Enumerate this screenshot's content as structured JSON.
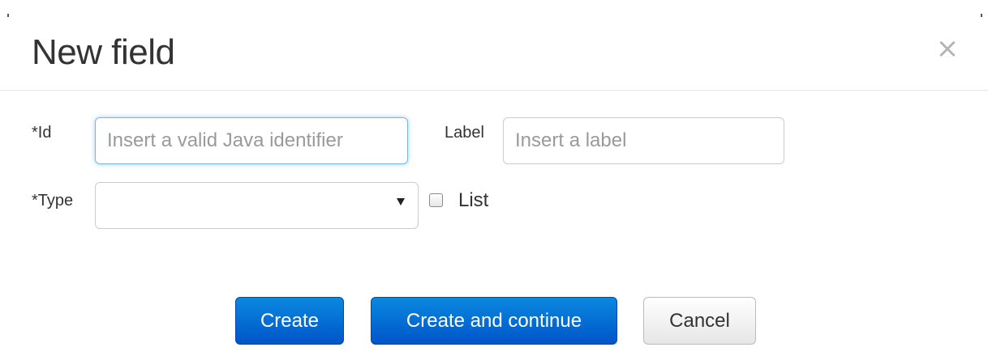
{
  "dialog": {
    "title": "New field",
    "close_symbol": "×"
  },
  "form": {
    "id_field": {
      "label": "*Id",
      "value": "",
      "placeholder": "Insert a valid Java identifier"
    },
    "label_field": {
      "label": "Label",
      "value": "",
      "placeholder": "Insert a label"
    },
    "type_field": {
      "label": "*Type",
      "selected": ""
    },
    "list_checkbox": {
      "label": "List",
      "checked": false
    }
  },
  "buttons": {
    "create": "Create",
    "create_and_continue": "Create and continue",
    "cancel": "Cancel"
  },
  "icons": {
    "close": "close-icon",
    "dropdown": "caret-down-icon"
  },
  "colors": {
    "primary_button": "#0a6fd6",
    "focus_border": "#7ab6e6",
    "title_text": "#333333"
  }
}
